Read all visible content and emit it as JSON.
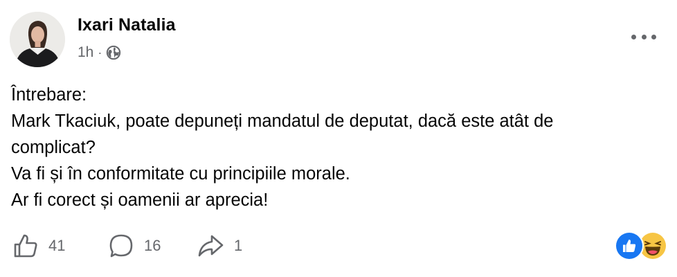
{
  "post": {
    "author": "Ixari Natalia",
    "time": "1h",
    "separator": "·",
    "privacy_icon": "globe-icon",
    "more_icon": "more-options-icon",
    "lines": [
      "Întrebare:",
      "Mark Tkaciuk, poate depuneți mandatul de deputat, dacă este atât de",
      "complicat?",
      "Va fi și în conformitate cu principiile morale.",
      "Ar fi corect și oamenii ar aprecia!"
    ],
    "likes": "41",
    "comments": "16",
    "shares": "1",
    "reactions": [
      "like-reaction-icon",
      "haha-reaction-icon"
    ]
  },
  "colors": {
    "text": "#050505",
    "secondary": "#65676b",
    "like_blue": "#0866ff",
    "haha_yellow": "#f7c544"
  }
}
